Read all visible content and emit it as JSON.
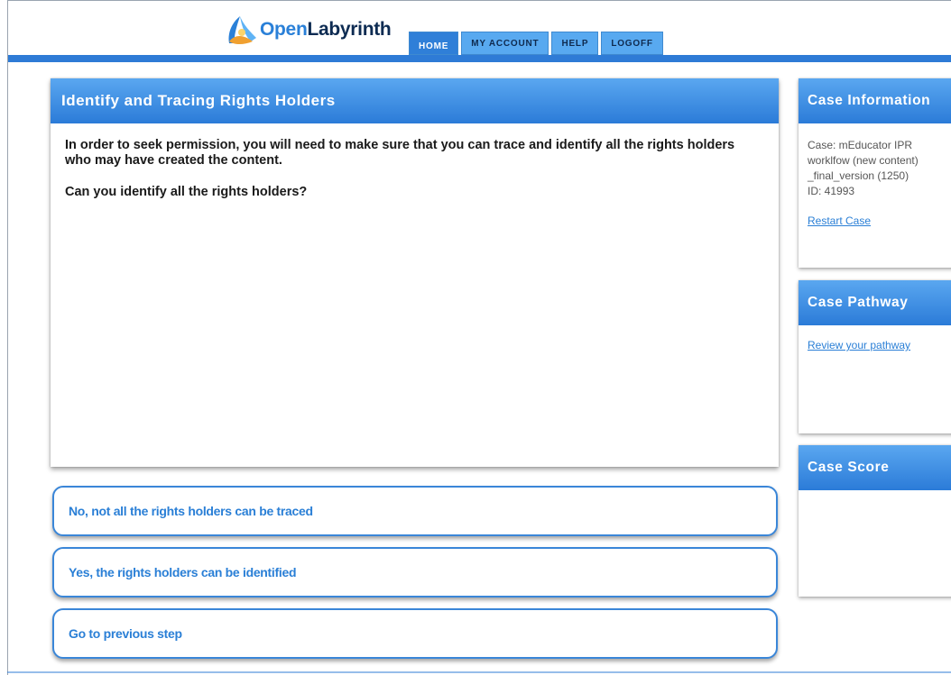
{
  "header": {
    "logo_open": "Open",
    "logo_labyrinth": "Labyrinth",
    "nav": [
      {
        "label": "HOME"
      },
      {
        "label": "MY ACCOUNT"
      },
      {
        "label": "HELP"
      },
      {
        "label": "LOGOFF"
      }
    ]
  },
  "main": {
    "title": "Identify and Tracing Rights Holders",
    "paragraph_1": "In order to seek permission, you will need to make sure that you can trace and identify all the rights holders who may have created the content.",
    "paragraph_2": "Can you identify all the rights holders?"
  },
  "options": [
    {
      "label": "No, not all the rights holders can be traced"
    },
    {
      "label": "Yes, the rights holders can be identified"
    },
    {
      "label": "Go to previous step"
    }
  ],
  "sidebar": {
    "case_info": {
      "title": "Case Information",
      "case_line": "Case: mEducator IPR worklfow (new content) _final_version (1250)",
      "id_line": "ID: 41993",
      "restart_link": "Restart Case"
    },
    "case_pathway": {
      "title": "Case Pathway",
      "review_link": "Review your pathway"
    },
    "case_score": {
      "title": "Case Score"
    }
  },
  "colors": {
    "accent": "#2e7bd6",
    "tab": "#58a9f0",
    "link": "#2a7fd6"
  },
  "icons": {
    "logo": "labyrinth-logo-icon"
  }
}
